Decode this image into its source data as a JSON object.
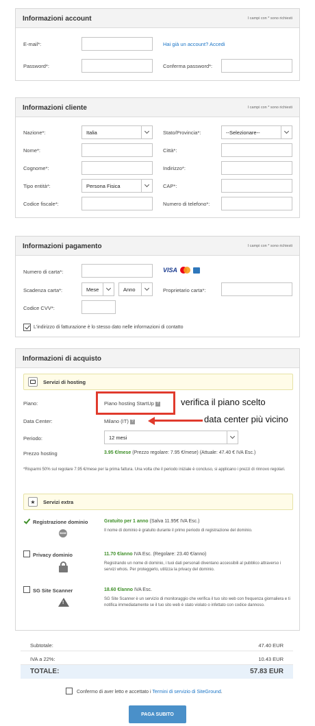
{
  "required_note": "I campi con * sono richiesti",
  "account": {
    "title": "Informazioni account",
    "email_label": "E-mail*:",
    "password_label": "Password*:",
    "login_link": "Hai già un account? Accedi",
    "confirm_password_label": "Conferma password*:"
  },
  "cliente": {
    "title": "Informazioni cliente",
    "nazione_label": "Nazione*:",
    "nazione_value": "Italia",
    "stato_label": "Stato/Provincia*:",
    "stato_value": "--Selezionare--",
    "nome_label": "Nome*:",
    "citta_label": "Città*:",
    "cognome_label": "Cognome*:",
    "indirizzo_label": "Indirizzo*:",
    "tipo_label": "Tipo entità*:",
    "tipo_value": "Persona Fisica",
    "cap_label": "CAP*:",
    "cf_label": "Codice fiscale*:",
    "telefono_label": "Numero di telefono*:"
  },
  "pagamento": {
    "title": "Informazioni pagamento",
    "carta_label": "Numero di carta*:",
    "card_brands": [
      "visa-icon",
      "mastercard-icon",
      "amex-icon"
    ],
    "visa_text": "VISA",
    "scadenza_label": "Scadenza carta*:",
    "mese_value": "Mese",
    "anno_value": "Anno",
    "proprietario_label": "Proprietario carta*:",
    "cvv_label": "Codice CVV*:",
    "billing_same_label": "L'indirizzo di fatturazione è lo stesso dato nelle informazioni di contatto"
  },
  "acquisto": {
    "title": "Informazioni di acquisto",
    "hosting_section": "Servizi di hosting",
    "piano_label": "Piano:",
    "piano_value": "Piano hosting StartUp",
    "datacenter_label": "Data Center:",
    "datacenter_value": "Milano (IT)",
    "periodo_label": "Periodo:",
    "periodo_value": "12 mesi",
    "prezzo_label": "Prezzo hosting",
    "prezzo_value": "3.95 €/mese",
    "prezzo_detail": "(Prezzo regolare: 7.95 €/mese) (Attuale: 47.40 € IVA Esc.)",
    "footnote": "*Risparmi 50% sul regolare 7.95 €/mese per la prima fattura. Una volta che il periodo iniziale è concluso, si applicano i prezzi di rinnovo regolari.",
    "extra_section": "Servizi extra",
    "extras": [
      {
        "name": "Registrazione dominio",
        "price": "Gratuito per 1 anno",
        "price_note": "(Salva 11.95€ IVA Esc.)",
        "desc": "Il nome di dominio è gratuito durante il primo periodo di registrazione del dominio."
      },
      {
        "name": "Privacy dominio",
        "price": "11.70 €/anno",
        "price_note": "IVA Esc. (Regolare: 23.40 €/anno)",
        "desc": "Registrando un nome di dominio, i tuoi dati personali diventano accessibili al pubblico attraverso i servizi whois. Per proteggerlo, utilizza la privacy del dominio."
      },
      {
        "name": "SG Site Scanner",
        "price": "18.60 €/anno",
        "price_note": "IVA Esc.",
        "desc": "SG Site Scanner è un servizio di monitoraggio che verifica il tuo sito web con frequenza giornaliera e ti notifica immediatamente se il tuo sito web è stato violato o infettato con codice dannoso."
      }
    ],
    "www_text": "WWW"
  },
  "annotations": {
    "piano": "verifica il piano scelto",
    "datacenter": "data center più vicino"
  },
  "summary": {
    "subtotale_label": "Subtotale:",
    "subtotale_value": "47.40 EUR",
    "iva_label": "IVA a 22%:",
    "iva_value": "10.43 EUR",
    "totale_label": "TOTALE:",
    "totale_value": "57.83 EUR"
  },
  "terms": {
    "prefix": "Confermo di aver letto e accettato i",
    "link": "Termini di servizio di SiteGround",
    "suffix": "."
  },
  "pay_button": "PAGA SUBITO",
  "colors": {
    "accent_link": "#1a74c6",
    "price_green": "#3f8f29",
    "annotation_red": "#e03a2c",
    "button_blue": "#4a90c9"
  }
}
